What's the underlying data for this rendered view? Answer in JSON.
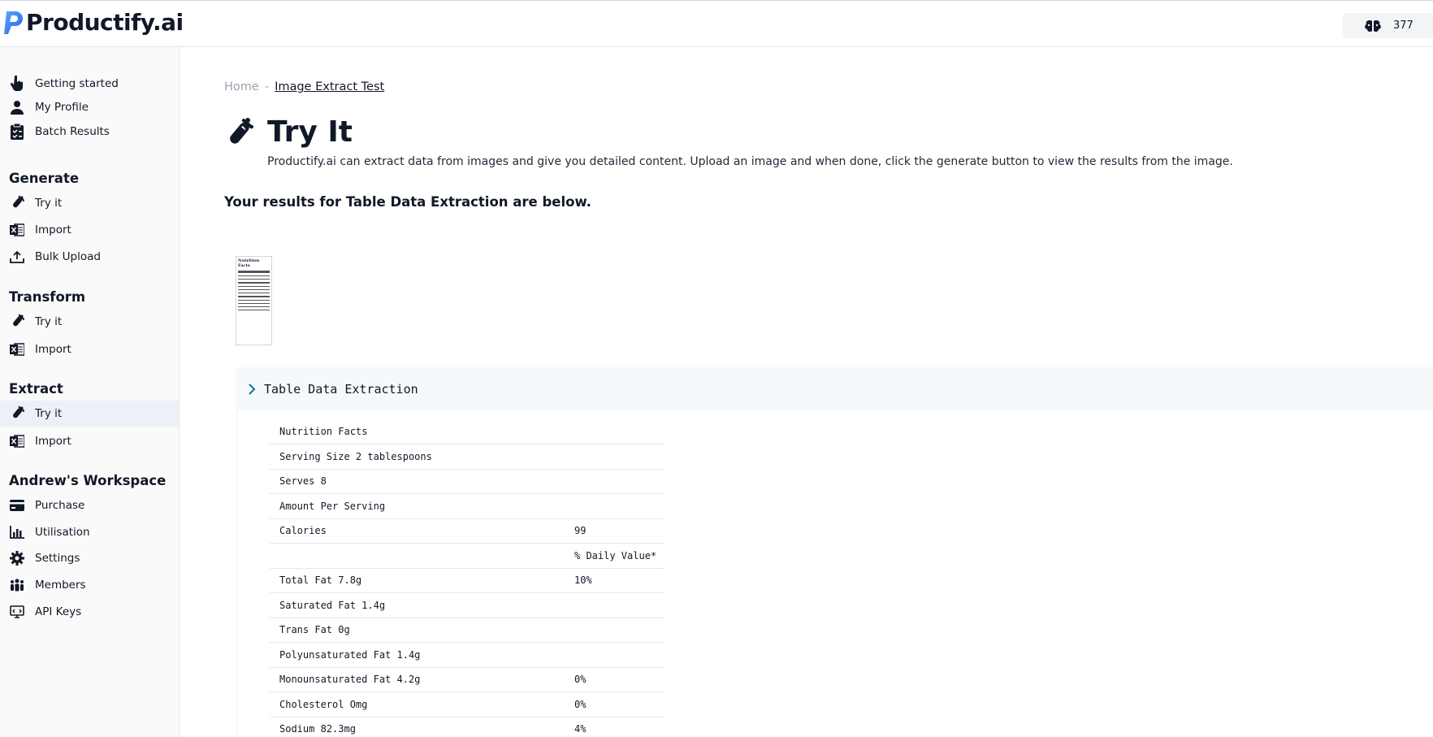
{
  "header": {
    "logo_text": "Productify.ai",
    "credits": "377",
    "brand_color": "#2563eb"
  },
  "sidebar": {
    "top_items": [
      {
        "label": "Getting started",
        "icon": "hand-pointer-icon"
      },
      {
        "label": "My Profile",
        "icon": "user-icon"
      },
      {
        "label": "Batch Results",
        "icon": "clipboard-check-icon"
      }
    ],
    "sections": [
      {
        "title": "Generate",
        "items": [
          {
            "label": "Try it",
            "icon": "flask-icon"
          },
          {
            "label": "Import",
            "icon": "excel-icon"
          },
          {
            "label": "Bulk Upload",
            "icon": "upload-icon"
          }
        ]
      },
      {
        "title": "Transform",
        "items": [
          {
            "label": "Try it",
            "icon": "flask-icon"
          },
          {
            "label": "Import",
            "icon": "excel-icon"
          }
        ]
      },
      {
        "title": "Extract",
        "items": [
          {
            "label": "Try it",
            "icon": "flask-icon",
            "active": true
          },
          {
            "label": "Import",
            "icon": "excel-icon"
          }
        ]
      },
      {
        "title": "Andrew's Workspace",
        "items": [
          {
            "label": "Purchase",
            "icon": "credit-card-icon"
          },
          {
            "label": "Utilisation",
            "icon": "bar-chart-icon"
          },
          {
            "label": "Settings",
            "icon": "gear-icon"
          },
          {
            "label": "Members",
            "icon": "users-icon"
          },
          {
            "label": "API Keys",
            "icon": "api-screen-icon"
          }
        ]
      }
    ]
  },
  "main": {
    "breadcrumb": {
      "home": "Home",
      "separator": "-",
      "current": "Image Extract Test"
    },
    "title": "Try It",
    "description": "Productify.ai can extract data from images and give you detailed content. Upload an image and when done, click the generate button to view the results from the image.",
    "results_heading": "Your results for Table Data Extraction are below.",
    "accordion_title": "Table Data Extraction",
    "table_rows": [
      [
        "Nutrition Facts",
        ""
      ],
      [
        "Serving Size 2 tablespoons",
        ""
      ],
      [
        "Serves 8",
        ""
      ],
      [
        "Amount Per Serving",
        ""
      ],
      [
        "Calories",
        "99"
      ],
      [
        "",
        "% Daily Value*"
      ],
      [
        "Total Fat 7.8g",
        "10%"
      ],
      [
        "Saturated Fat 1.4g",
        ""
      ],
      [
        "Trans Fat 0g",
        ""
      ],
      [
        "Polyunsaturated Fat 1.4g",
        ""
      ],
      [
        "Monounsaturated Fat 4.2g",
        "0%"
      ],
      [
        "Cholesterol Omg",
        "0%"
      ],
      [
        "Sodium 82.3mg",
        "4%"
      ]
    ]
  }
}
